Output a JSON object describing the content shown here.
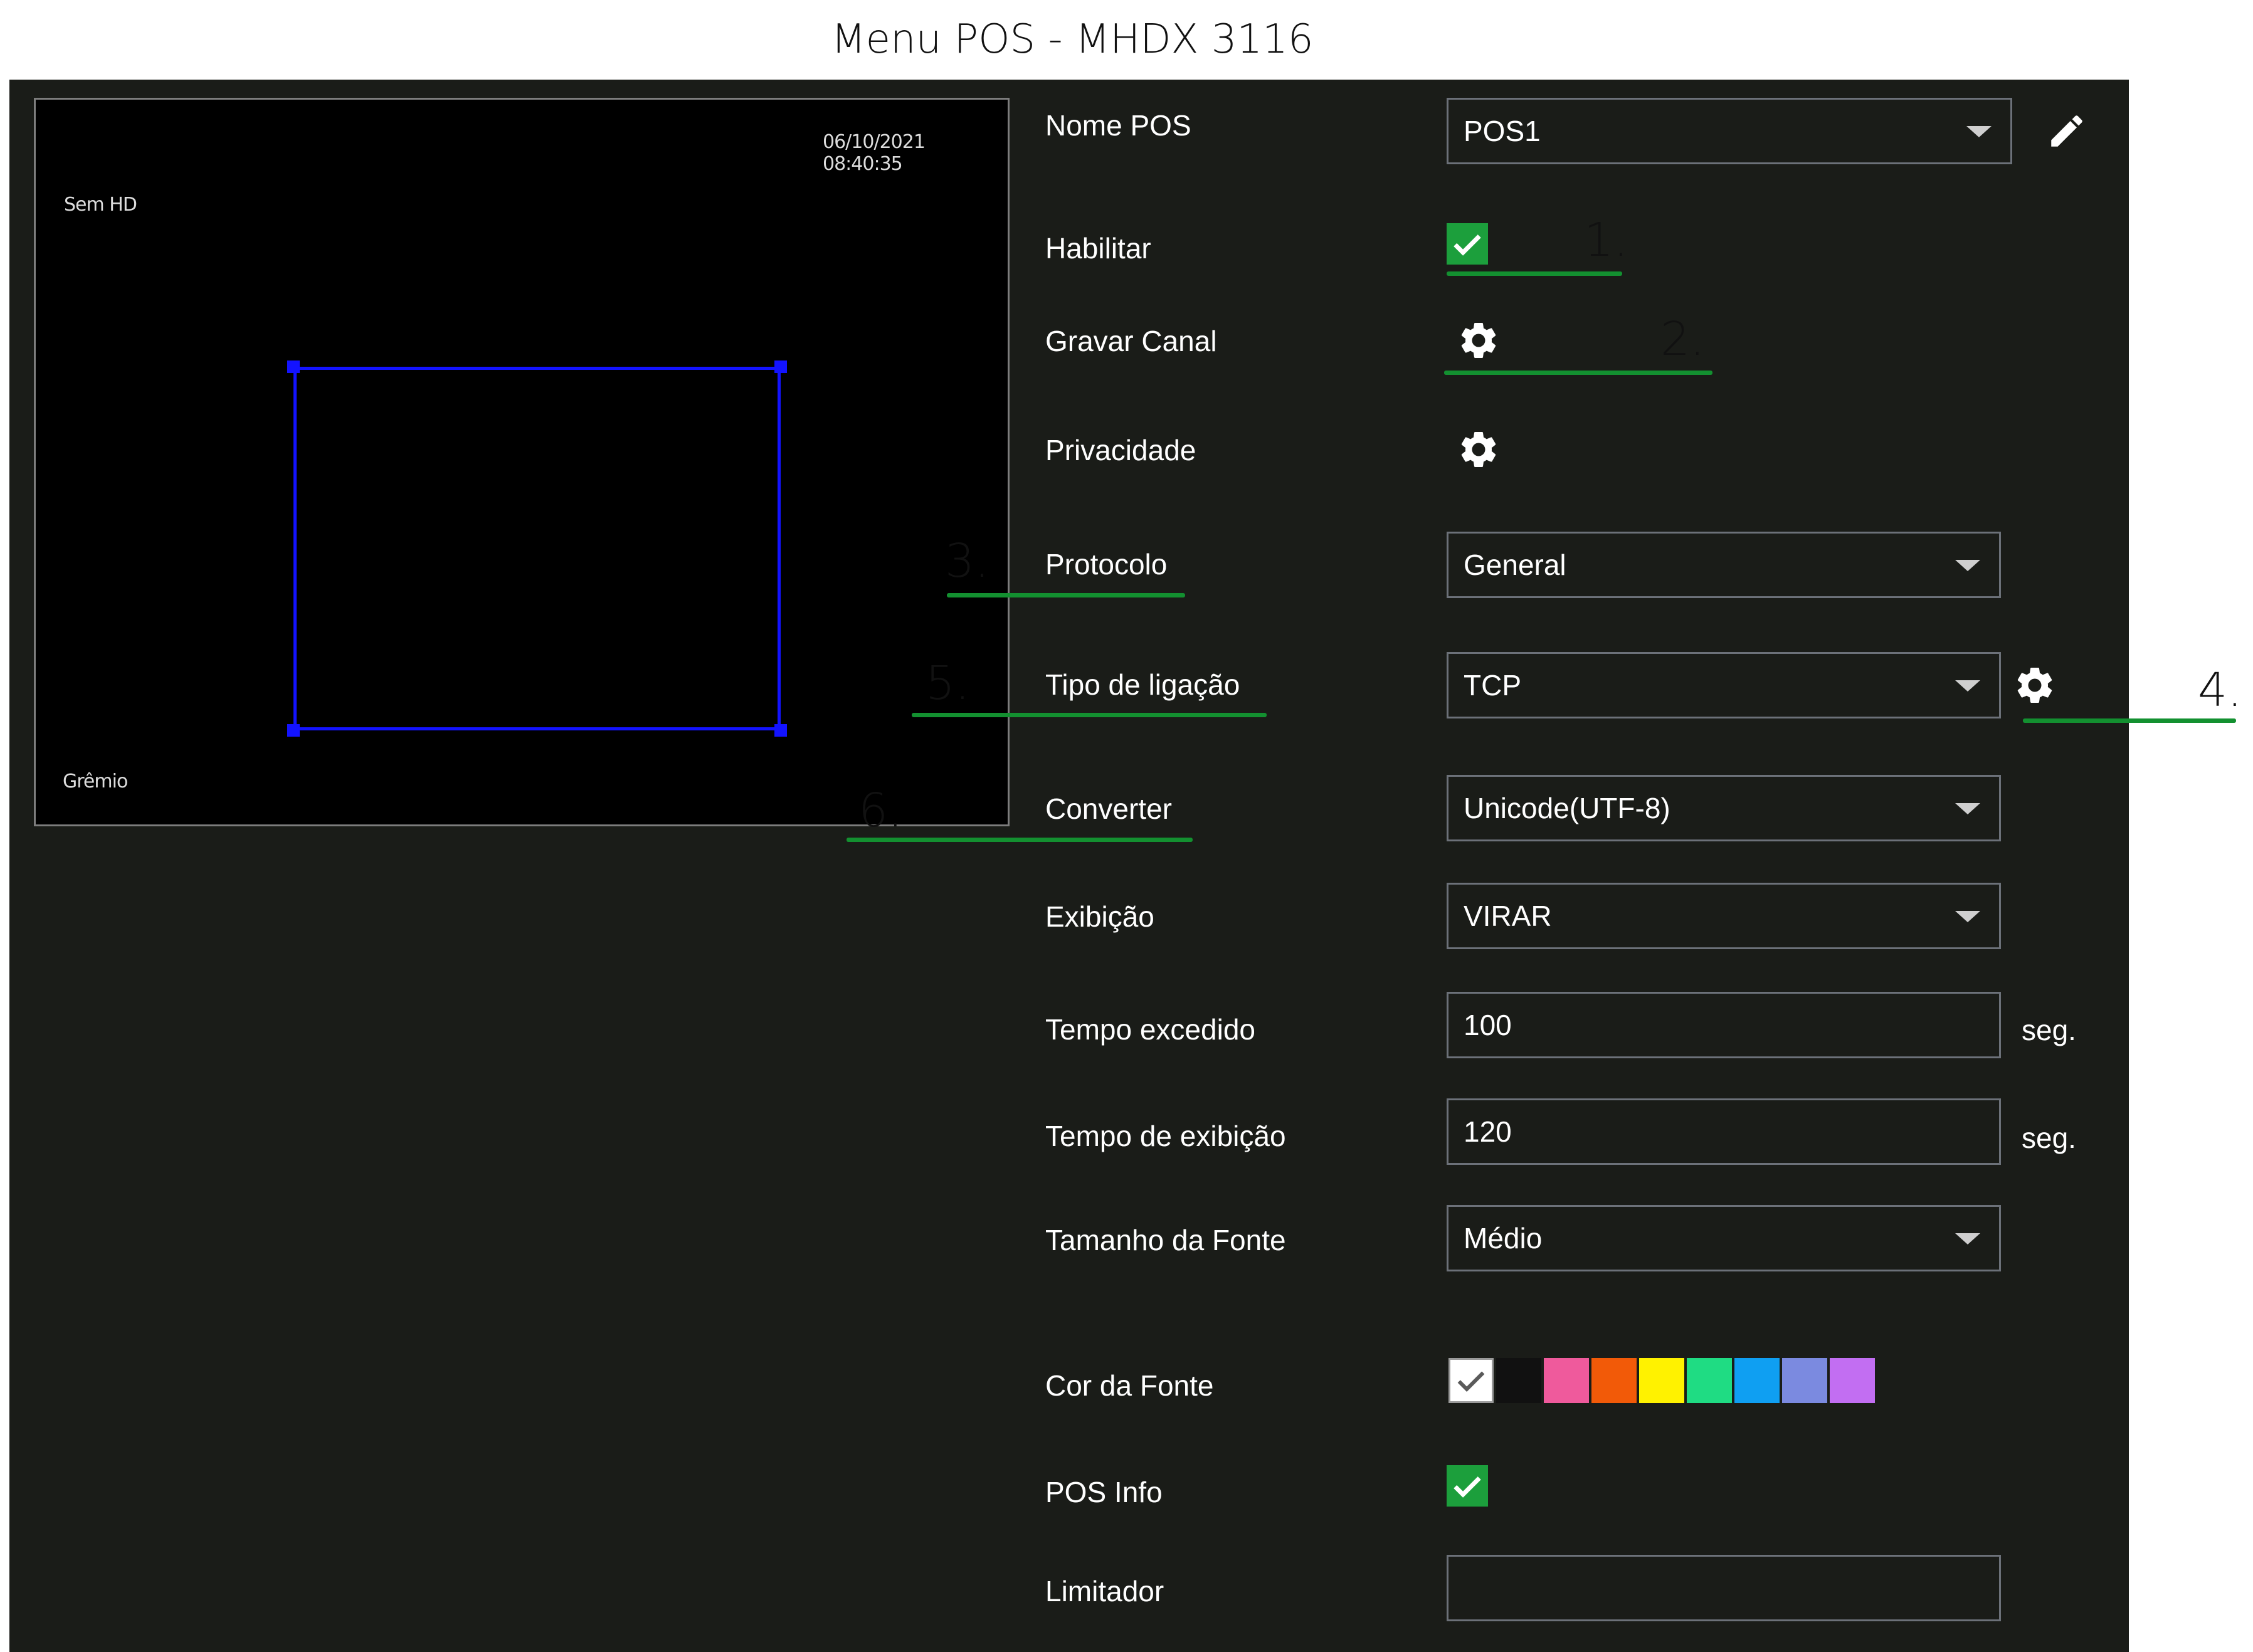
{
  "title": "Menu POS - MHDX 3116",
  "preview": {
    "timestamp": "06/10/2021 08:40:35",
    "top_left_text": "Sem HD",
    "bottom_left_text": "Grêmio"
  },
  "fields": {
    "nome_pos": {
      "label": "Nome POS",
      "value": "POS1"
    },
    "habilitar": {
      "label": "Habilitar",
      "checked": true
    },
    "gravar_canal": {
      "label": "Gravar Canal"
    },
    "privacidade": {
      "label": "Privacidade"
    },
    "protocolo": {
      "label": "Protocolo",
      "value": "General"
    },
    "tipo_ligacao": {
      "label": "Tipo de ligação",
      "value": "TCP"
    },
    "converter": {
      "label": "Converter",
      "value": "Unicode(UTF-8)"
    },
    "exibicao": {
      "label": "Exibição",
      "value": "VIRAR"
    },
    "tempo_excedido": {
      "label": "Tempo excedido",
      "value": "100",
      "unit": "seg."
    },
    "tempo_exibicao": {
      "label": "Tempo de exibição",
      "value": "120",
      "unit": "seg."
    },
    "tamanho_fonte": {
      "label": "Tamanho da Fonte",
      "value": "Médio"
    },
    "cor_fonte": {
      "label": "Cor da Fonte",
      "selected": "#ffffff",
      "colors": [
        "#ffffff",
        "#111111",
        "#ef5a9c",
        "#f25a08",
        "#fff200",
        "#1fdc83",
        "#0f9ff2",
        "#7b8ae0",
        "#c26ef2"
      ]
    },
    "pos_info": {
      "label": "POS Info",
      "checked": true
    },
    "limitador": {
      "label": "Limitador",
      "value": ""
    }
  },
  "annotations": {
    "n1": "1.",
    "n2": "2.",
    "n3": "3.",
    "n4": "4.",
    "n5": "5.",
    "n6": "6."
  },
  "colors": {
    "panel": "#1a1c18",
    "accent_green": "#1c9f3c",
    "annotation_line": "#139030",
    "region": "#1313ff"
  },
  "icons": {
    "edit": "pencil-icon",
    "settings": "gear-icon",
    "check": "check-icon",
    "dropdown": "caret-down-icon"
  }
}
